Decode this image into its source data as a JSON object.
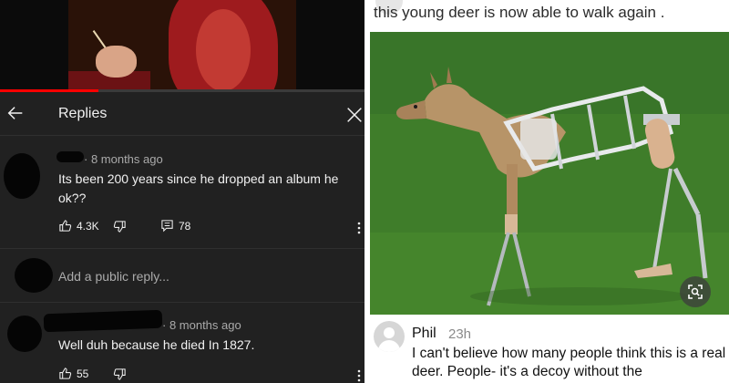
{
  "video": {
    "progress_fraction": 0.27
  },
  "replies_panel": {
    "title": "Replies",
    "add_reply_placeholder": "Add a public reply...",
    "comments": [
      {
        "meta": "· 8 months ago",
        "text": "Its been 200 years since he dropped an album he ok??",
        "likes": "4.3K",
        "replies": "78"
      },
      {
        "meta": "· 8 months ago",
        "text": "Well duh because he died In 1827.",
        "likes": "55"
      }
    ]
  },
  "post": {
    "caption": "this young deer is now able to walk again .",
    "comment": {
      "author": "Phil",
      "time": "23h",
      "text": "I can't believe how many people think this is a real deer. People- it's a decoy without the"
    }
  },
  "colors": {
    "youtube_dark_bg": "#212121",
    "progress_red": "#ff0000",
    "grass_green": "#3f7d2a"
  }
}
